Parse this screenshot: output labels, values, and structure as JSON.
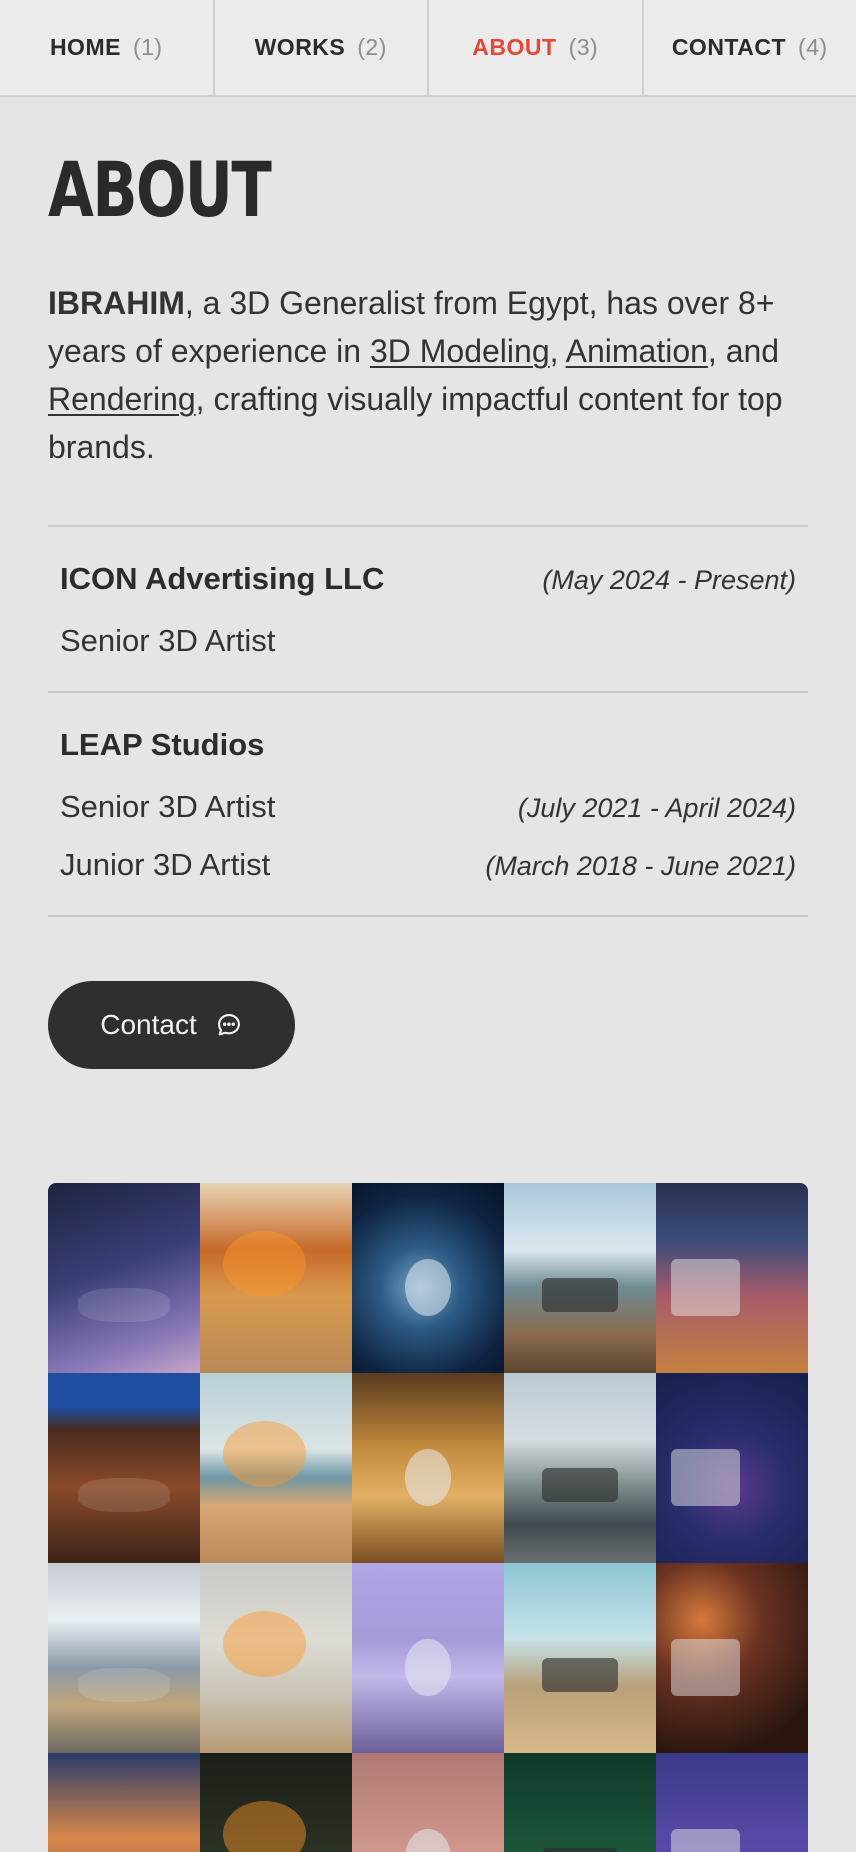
{
  "nav": [
    {
      "label": "HOME",
      "num": "(1)"
    },
    {
      "label": "WORKS",
      "num": "(2)"
    },
    {
      "label": "ABOUT",
      "num": "(3)"
    },
    {
      "label": "CONTACT",
      "num": "(4)"
    }
  ],
  "page": {
    "title": "ABOUT"
  },
  "bio": {
    "name": "IBRAHIM",
    "text1": ", a 3D Generalist from Egypt, has over 8+ years of experience in ",
    "skill1": "3D Modeling",
    "sep1": ", ",
    "skill2": "Animation",
    "sep2": ", and ",
    "skill3": "Rendering",
    "text2": ", crafting visually impactful content for top brands."
  },
  "experience": [
    {
      "company": "ICON Advertising LLC",
      "roles": [
        {
          "title": "Senior 3D Artist",
          "period": "(May 2024 - Present)"
        }
      ]
    },
    {
      "company": "LEAP Studios",
      "roles": [
        {
          "title": "Senior 3D Artist",
          "period": "(July 2021 - April 2024)"
        },
        {
          "title": "Junior 3D Artist",
          "period": "(March 2018 - June 2021)"
        }
      ]
    }
  ],
  "contact_button": {
    "label": "Contact",
    "icon": "chat-bubble-icon"
  },
  "colors": {
    "accent": "#e24a35",
    "background": "#e5e5e5",
    "button": "#2f2f2f"
  },
  "gallery": [
    {
      "name": "cosmic-nebula",
      "bg": "linear-gradient(160deg,#1c2440 0%,#3b3f78 45%,#8a79b8 80%,#c9a6c8 100%)"
    },
    {
      "name": "offroad-explosion",
      "bg": "linear-gradient(180deg,#e9d3b5 0%,#c66a2a 35%,#d89a4e 60%,#b88858 100%)"
    },
    {
      "name": "astronaut-earth",
      "bg": "radial-gradient(circle at 45% 55%,#7aa7c9 0%,#2c5b85 30%,#0e2240 70%,#061427 100%)"
    },
    {
      "name": "jeep-beach",
      "bg": "linear-gradient(180deg,#a9c7da 0%,#dbe7ee 35%,#6f8a92 55%,#8a6b50 80%,#5b4430 100%)"
    },
    {
      "name": "food-truck-night",
      "bg": "linear-gradient(180deg,#2a3150 0%,#3b4b7a 30%,#a85c6a 60%,#c4813f 100%)"
    },
    {
      "name": "cave-figures",
      "bg": "linear-gradient(180deg,#1f4ea0 0%,#1f4ea0 18%,#4a2b1d 30%,#8a4a2a 60%,#3c2418 100%)"
    },
    {
      "name": "red-truck-dunes",
      "bg": "linear-gradient(180deg,#b8cfd6 0%,#dbe5e5 40%,#6f97a6 55%,#d7a873 70%,#b98a58 100%)"
    },
    {
      "name": "golden-city-cars",
      "bg": "linear-gradient(180deg,#5a3b1e 0%,#c58c3e 40%,#e2b065 65%,#7a4e22 100%)"
    },
    {
      "name": "suv-city-street",
      "bg": "linear-gradient(180deg,#b9cad3 0%,#d5dde0 35%,#7c8a8a 60%,#3e4a4f 80%,#6b7070 100%)"
    },
    {
      "name": "vinyl-record-guy",
      "bg": "radial-gradient(circle at 50% 60%,#5b3a8a 0%,#2a2d6e 40%,#15204a 100%)"
    },
    {
      "name": "floating-islands-food",
      "bg": "linear-gradient(180deg,#c7ccd4 0%,#e9eef2 30%,#8a9aa8 55%,#c0a57a 75%,#6d6a63 100%)"
    },
    {
      "name": "peanut-butter-jar",
      "bg": "linear-gradient(180deg,#c9c9c5 0%,#dedcd5 40%,#c9c3b5 70%,#b69a73 100%)"
    },
    {
      "name": "piano-sky",
      "bg": "linear-gradient(180deg,#b1a6e6 0%,#a69bd9 40%,#c2b8ea 60%,#6b5f9a 100%)"
    },
    {
      "name": "desert-picnic-balloon",
      "bg": "linear-gradient(180deg,#8ec6d6 0%,#c6e2e8 40%,#b8a07a 65%,#d8b98a 100%)"
    },
    {
      "name": "spiderman-hand-phone",
      "bg": "radial-gradient(circle at 30% 30%,#d67a3a 0%,#6a3222 35%,#2a160f 80%)"
    },
    {
      "name": "bmx-rider",
      "bg": "linear-gradient(180deg,#2a3b6a 0%,#d9884a 45%,#5a3e7a 100%)"
    },
    {
      "name": "dark-tree",
      "bg": "linear-gradient(180deg,#1a1e18 0%,#2d3524 60%,#1a1e18 100%)"
    },
    {
      "name": "pink-shapes",
      "bg": "linear-gradient(180deg,#b07a72 0%,#cf968c 50%,#9aa6a8 100%)"
    },
    {
      "name": "green-windmills",
      "bg": "linear-gradient(180deg,#0f3a2a 0%,#1f5a3e 60%,#d8d0c0 100%)"
    },
    {
      "name": "purple-buildings",
      "bg": "linear-gradient(180deg,#3a3a8a 0%,#5a4aa8 50%,#2a2a6a 100%)"
    }
  ]
}
